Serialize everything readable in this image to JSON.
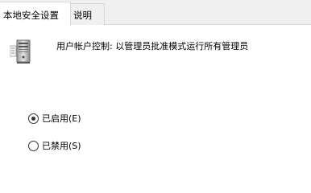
{
  "tabs": [
    {
      "label": "本地安全设置",
      "active": true
    },
    {
      "label": "说明",
      "active": false
    }
  ],
  "policy": {
    "icon": "server-computer-icon",
    "title": "用户帐户控制: 以管理员批准模式运行所有管理员"
  },
  "options": {
    "enabled": {
      "label": "已启用(E)",
      "selected": true
    },
    "disabled": {
      "label": "已禁用(S)",
      "selected": false
    }
  }
}
